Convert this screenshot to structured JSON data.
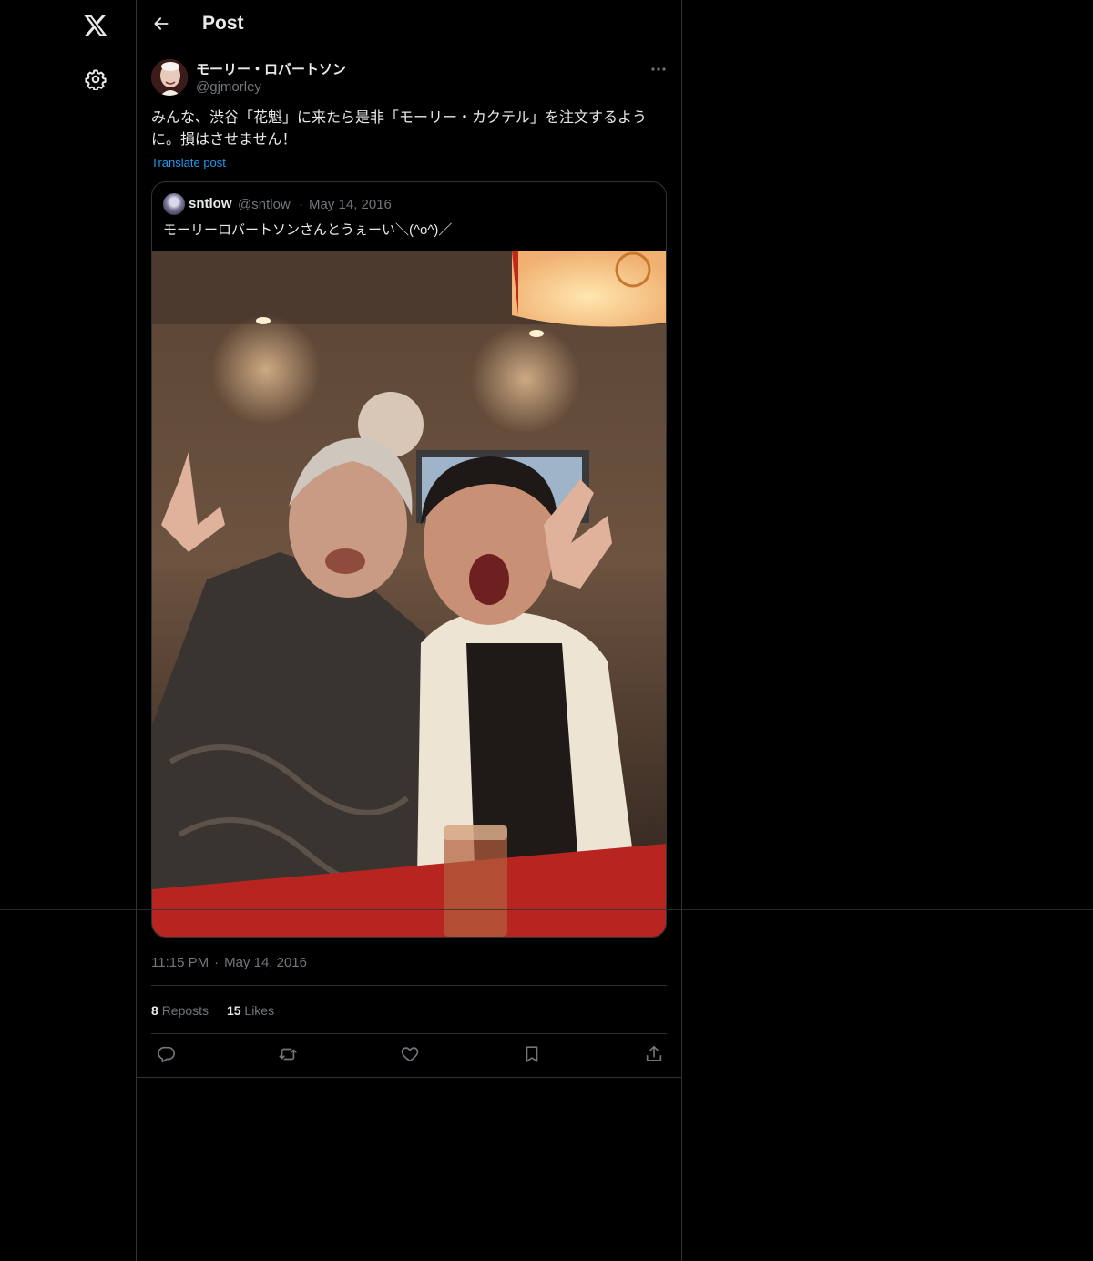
{
  "header": {
    "title": "Post"
  },
  "post": {
    "author_name": "モーリー・ロバートソン",
    "author_handle": "@gjmorley",
    "text": "みんな、渋谷「花魁」に来たら是非「モーリー・カクテル」を注文するように。損はさせません！",
    "translate_label": "Translate post",
    "time": "11:15 PM",
    "date": "May 14, 2016"
  },
  "quote": {
    "name": "sntlow",
    "handle": "@sntlow",
    "separator": "·",
    "date": "May 14, 2016",
    "text": "モーリーロバートソンさんとうぇーい＼(^o^)／"
  },
  "stats": {
    "reposts_count": "8",
    "reposts_label": "Reposts",
    "likes_count": "15",
    "likes_label": "Likes"
  },
  "icons": {
    "logo": "x-logo-icon",
    "settings": "gear-icon",
    "back": "arrow-left-icon",
    "more": "more-dots-icon",
    "reply": "reply-icon",
    "repost": "repost-icon",
    "like": "heart-icon",
    "bookmark": "bookmark-icon",
    "share": "share-icon"
  },
  "colors": {
    "background": "#000000",
    "text": "#e7e9ea",
    "muted": "#71767b",
    "link": "#1d9bf0",
    "border": "#2f3336"
  }
}
